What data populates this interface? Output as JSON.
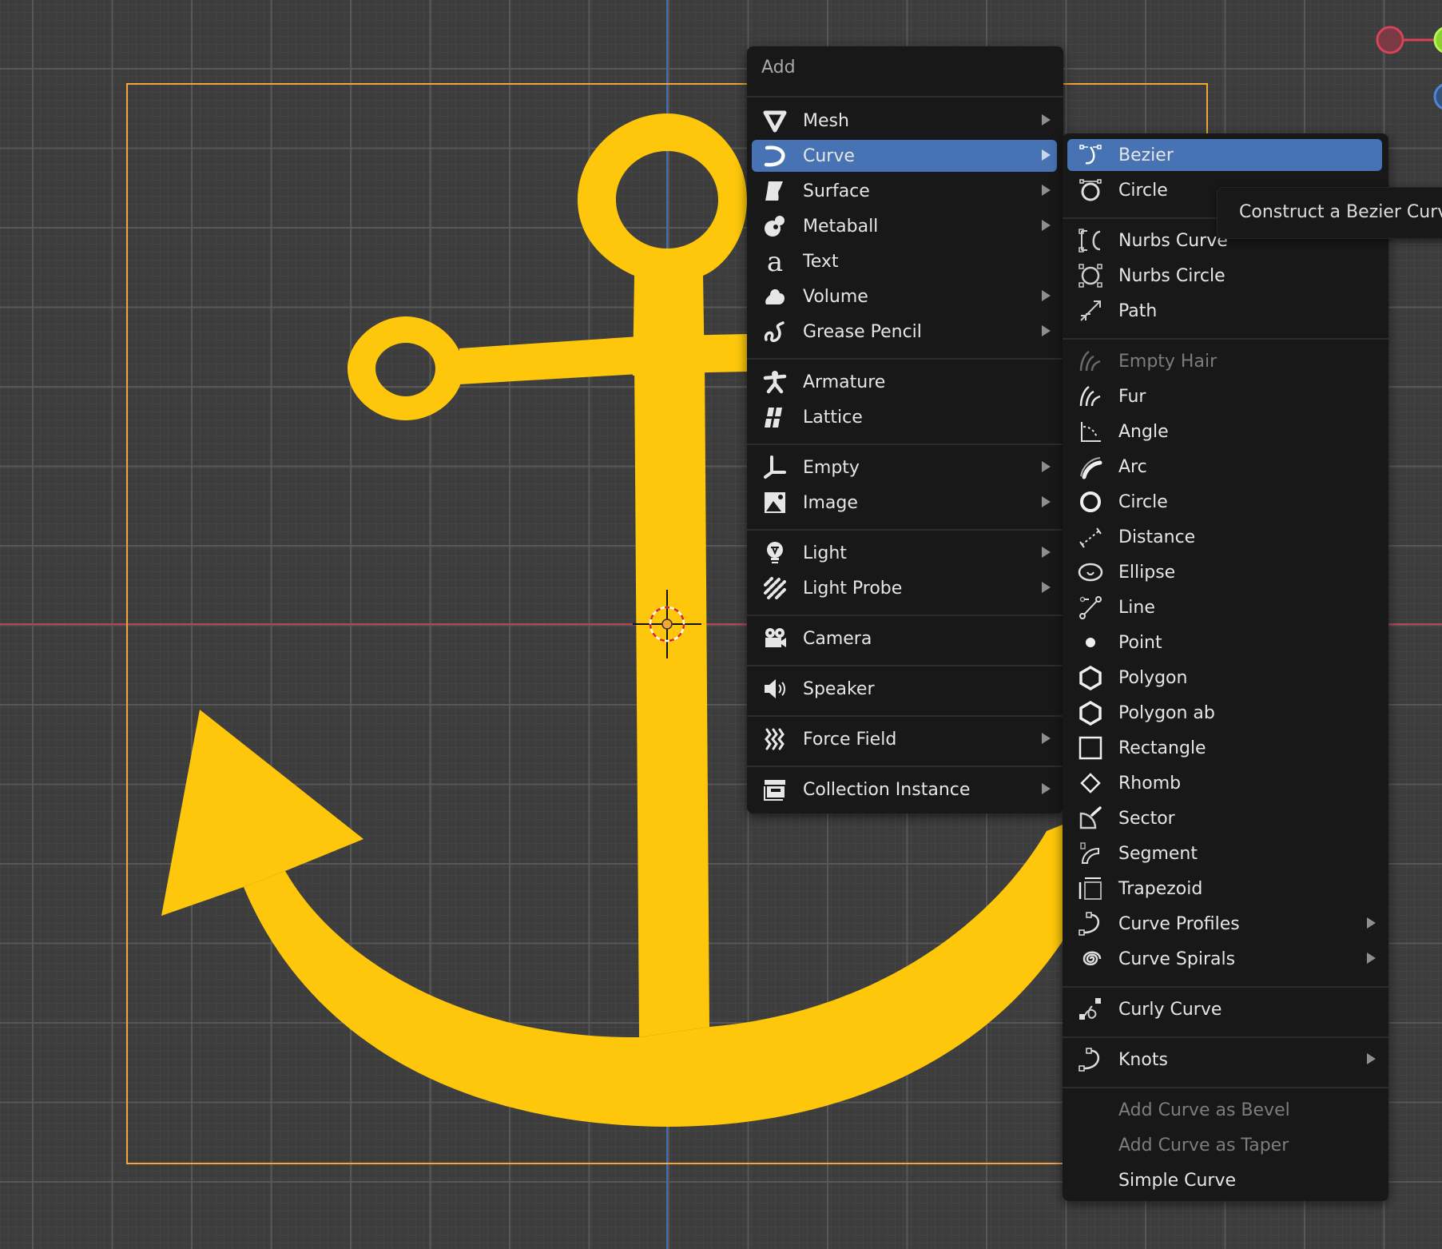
{
  "colors": {
    "accent": "#4772b3",
    "curve_fill": "#fec70b",
    "selection_outline": "#f3a537",
    "axis_x": "#b8444f",
    "axis_z": "#3e6fb6",
    "menu_bg": "#181818",
    "viewport_bg": "#3d3d3d"
  },
  "add_menu": {
    "title": "Add",
    "items": [
      {
        "label": "Mesh",
        "icon": "mesh-icon",
        "submenu": true
      },
      {
        "label": "Curve",
        "icon": "curve-icon",
        "submenu": true,
        "active": true
      },
      {
        "label": "Surface",
        "icon": "surface-icon",
        "submenu": true
      },
      {
        "label": "Metaball",
        "icon": "metaball-icon",
        "submenu": true
      },
      {
        "label": "Text",
        "icon": "text-icon",
        "submenu": false
      },
      {
        "label": "Volume",
        "icon": "volume-icon",
        "submenu": true
      },
      {
        "label": "Grease Pencil",
        "icon": "grease-pencil-icon",
        "submenu": true
      },
      {
        "label": "Armature",
        "icon": "armature-icon",
        "submenu": false
      },
      {
        "label": "Lattice",
        "icon": "lattice-icon",
        "submenu": false
      },
      {
        "label": "Empty",
        "icon": "empty-icon",
        "submenu": true
      },
      {
        "label": "Image",
        "icon": "image-icon",
        "submenu": true
      },
      {
        "label": "Light",
        "icon": "light-icon",
        "submenu": true
      },
      {
        "label": "Light Probe",
        "icon": "light-probe-icon",
        "submenu": true
      },
      {
        "label": "Camera",
        "icon": "camera-icon",
        "submenu": false
      },
      {
        "label": "Speaker",
        "icon": "speaker-icon",
        "submenu": false
      },
      {
        "label": "Force Field",
        "icon": "force-field-icon",
        "submenu": true
      },
      {
        "label": "Collection Instance",
        "icon": "collection-instance-icon",
        "submenu": true
      }
    ]
  },
  "curve_menu": {
    "items": [
      {
        "label": "Bezier",
        "icon": "bezier-icon",
        "active": true
      },
      {
        "label": "Circle",
        "icon": "bezier-circle-icon"
      },
      {
        "label": "Nurbs Curve",
        "icon": "nurbs-curve-icon"
      },
      {
        "label": "Nurbs Circle",
        "icon": "nurbs-circle-icon"
      },
      {
        "label": "Path",
        "icon": "path-icon"
      },
      {
        "label": "Empty Hair",
        "icon": "empty-hair-icon",
        "disabled": true
      },
      {
        "label": "Fur",
        "icon": "fur-icon"
      },
      {
        "label": "Angle",
        "icon": "angle-icon"
      },
      {
        "label": "Arc",
        "icon": "arc-icon"
      },
      {
        "label": "Circle",
        "icon": "circle-icon"
      },
      {
        "label": "Distance",
        "icon": "distance-icon"
      },
      {
        "label": "Ellipse",
        "icon": "ellipse-icon"
      },
      {
        "label": "Line",
        "icon": "line-icon"
      },
      {
        "label": "Point",
        "icon": "point-icon"
      },
      {
        "label": "Polygon",
        "icon": "polygon-icon"
      },
      {
        "label": "Polygon ab",
        "icon": "polygon-ab-icon"
      },
      {
        "label": "Rectangle",
        "icon": "rectangle-icon"
      },
      {
        "label": "Rhomb",
        "icon": "rhomb-icon"
      },
      {
        "label": "Sector",
        "icon": "sector-icon"
      },
      {
        "label": "Segment",
        "icon": "segment-icon"
      },
      {
        "label": "Trapezoid",
        "icon": "trapezoid-icon"
      },
      {
        "label": "Curve Profiles",
        "icon": "curve-profiles-icon",
        "submenu": true
      },
      {
        "label": "Curve Spirals",
        "icon": "curve-spirals-icon",
        "submenu": true
      },
      {
        "label": "Curly Curve",
        "icon": "curly-curve-icon"
      },
      {
        "label": "Knots",
        "icon": "knots-icon",
        "submenu": true
      },
      {
        "label": "Add Curve as Bevel",
        "icon": "",
        "disabled": true
      },
      {
        "label": "Add Curve as Taper",
        "icon": "",
        "disabled": true
      },
      {
        "label": "Simple Curve",
        "icon": ""
      }
    ]
  },
  "tooltip": {
    "text": "Construct a Bezier Curve"
  }
}
